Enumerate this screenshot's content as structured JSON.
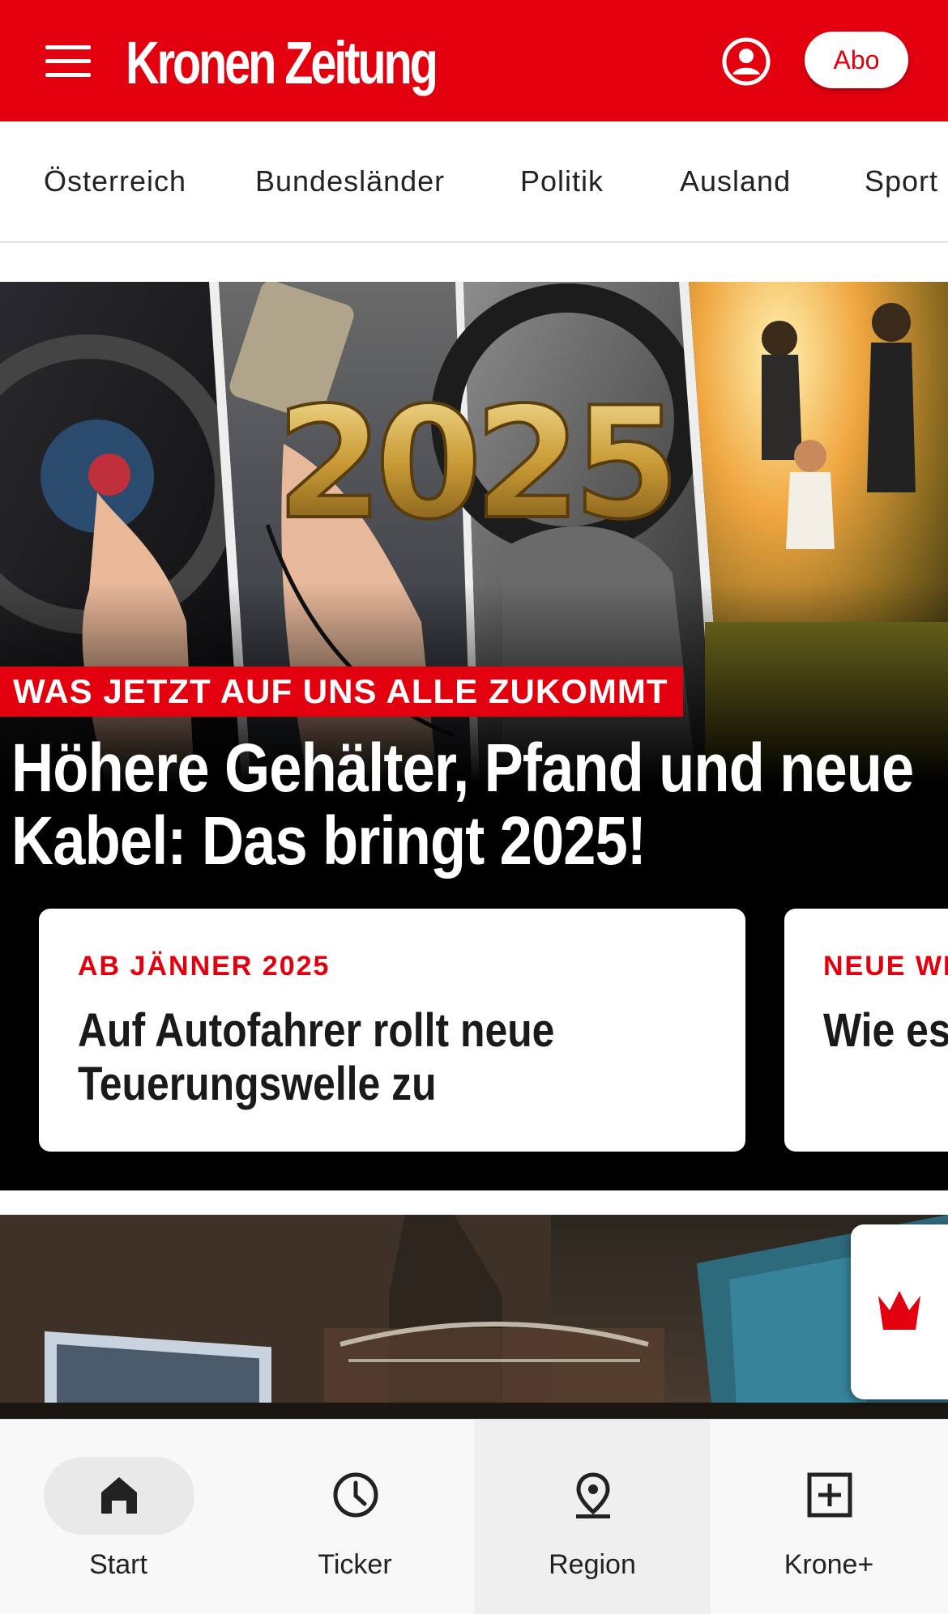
{
  "header": {
    "logo_text": "Kronen Zeitung",
    "abo_label": "Abo",
    "brand_color": "#e2000f"
  },
  "nav": {
    "items": [
      "Österreich",
      "Bundesländer",
      "Politik",
      "Ausland",
      "Sport"
    ]
  },
  "hero": {
    "image_text": "2025",
    "kicker": "WAS JETZT AUF UNS ALLE ZUKOMMT",
    "headline": "Höhere Gehälter, Pfand und neue Kabel: Das bringt 2025!",
    "cards": [
      {
        "kicker": "AB JÄNNER 2025",
        "title": "Auf Autofahrer rollt neue Teuerungswelle zu"
      },
      {
        "kicker": "NEUE WE",
        "title": "Wie es weiter"
      }
    ]
  },
  "floating": {
    "icon": "crown-icon"
  },
  "bottom_nav": {
    "items": [
      {
        "label": "Start",
        "icon": "home-icon"
      },
      {
        "label": "Ticker",
        "icon": "clock-icon"
      },
      {
        "label": "Region",
        "icon": "location-pin-icon"
      },
      {
        "label": "Krone+",
        "icon": "plus-box-icon"
      }
    ]
  }
}
